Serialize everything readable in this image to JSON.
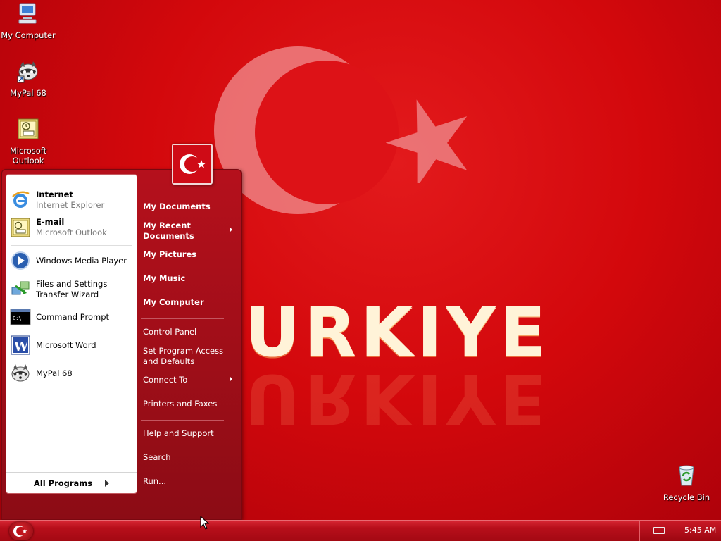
{
  "wallpaper": {
    "word": "URKIYE",
    "colors": {
      "background": "#d3080c",
      "crescent": "#ef8a8c",
      "text": "#f4a05a"
    }
  },
  "desktop": {
    "icons": [
      {
        "label": "My Computer",
        "icon": "my-computer-icon"
      },
      {
        "label": "MyPal 68",
        "icon": "mypal-raccoon-icon"
      },
      {
        "label": "Microsoft Outlook",
        "icon": "outlook-icon"
      },
      {
        "label": "Recycle Bin",
        "icon": "recycle-bin-icon"
      }
    ]
  },
  "start_menu": {
    "pinned": [
      {
        "title": "Internet",
        "subtitle": "Internet Explorer",
        "icon": "internet-explorer-icon"
      },
      {
        "title": "E-mail",
        "subtitle": "Microsoft Outlook",
        "icon": "outlook-icon"
      }
    ],
    "recent": [
      {
        "title": "Windows Media Player",
        "icon": "media-player-icon"
      },
      {
        "title": "Files and Settings Transfer Wizard",
        "icon": "transfer-wizard-icon"
      },
      {
        "title": "Command Prompt",
        "icon": "command-prompt-icon"
      },
      {
        "title": "Microsoft Word",
        "icon": "word-icon"
      },
      {
        "title": "MyPal 68",
        "icon": "mypal-raccoon-icon"
      }
    ],
    "all_programs": "All Programs",
    "places": [
      {
        "label": "My Documents",
        "submenu": false
      },
      {
        "label": "My Recent Documents",
        "submenu": true
      },
      {
        "label": "My Pictures",
        "submenu": false
      },
      {
        "label": "My Music",
        "submenu": false
      },
      {
        "label": "My Computer",
        "submenu": false
      }
    ],
    "system": [
      {
        "label": "Control Panel",
        "submenu": false
      },
      {
        "label": "Set Program Access and Defaults",
        "submenu": false
      },
      {
        "label": "Connect To",
        "submenu": true
      },
      {
        "label": "Printers and Faxes",
        "submenu": false
      }
    ],
    "help": [
      {
        "label": "Help and Support"
      },
      {
        "label": "Search"
      },
      {
        "label": "Run..."
      }
    ],
    "colors": {
      "panel": "#a80e18",
      "left_pane": "#ffffff"
    }
  },
  "taskbar": {
    "clock": "5:45 AM",
    "tray_icons": [
      "keyboard-icon"
    ],
    "colors": {
      "bar": "#b80f1b"
    }
  }
}
